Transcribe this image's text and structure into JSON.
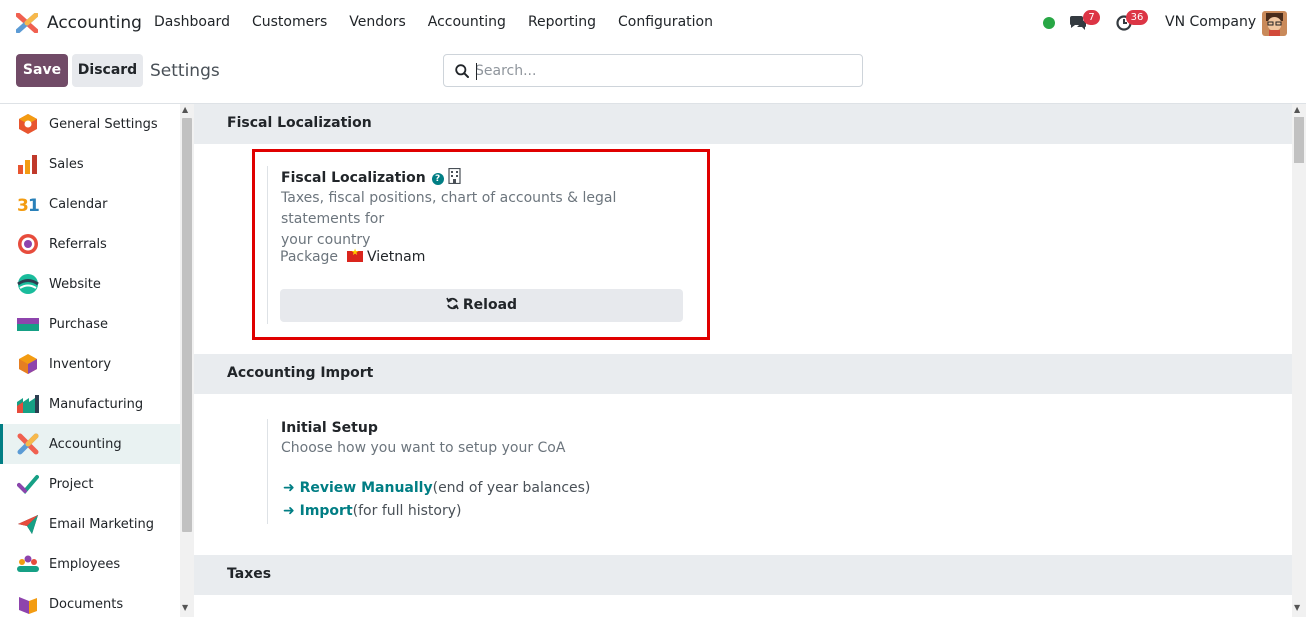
{
  "app": {
    "name": "Accounting"
  },
  "menu": [
    "Dashboard",
    "Customers",
    "Vendors",
    "Accounting",
    "Reporting",
    "Configuration"
  ],
  "systray": {
    "chat_count": "7",
    "activity_count": "36",
    "company": "VN Company"
  },
  "control": {
    "save_label": "Save",
    "discard_label": "Discard",
    "title": "Settings",
    "search_placeholder": "Search..."
  },
  "sidebar": {
    "items": [
      {
        "label": "General Settings",
        "icon": "general-settings-icon"
      },
      {
        "label": "Sales",
        "icon": "sales-icon"
      },
      {
        "label": "Calendar",
        "icon": "calendar-icon"
      },
      {
        "label": "Referrals",
        "icon": "referrals-icon"
      },
      {
        "label": "Website",
        "icon": "website-icon"
      },
      {
        "label": "Purchase",
        "icon": "purchase-icon"
      },
      {
        "label": "Inventory",
        "icon": "inventory-icon"
      },
      {
        "label": "Manufacturing",
        "icon": "manufacturing-icon"
      },
      {
        "label": "Accounting",
        "icon": "accounting-icon"
      },
      {
        "label": "Project",
        "icon": "project-icon"
      },
      {
        "label": "Email Marketing",
        "icon": "email-marketing-icon"
      },
      {
        "label": "Employees",
        "icon": "employees-icon"
      },
      {
        "label": "Documents",
        "icon": "documents-icon"
      }
    ],
    "active": "Accounting"
  },
  "sections": {
    "fiscal": {
      "header": "Fiscal Localization",
      "title": "Fiscal Localization",
      "desc_line1": "Taxes, fiscal positions, chart of accounts & legal statements for",
      "desc_line2": "your country",
      "package_label": "Package",
      "package_value": "Vietnam",
      "reload_label": "Reload"
    },
    "import": {
      "header": "Accounting Import",
      "title": "Initial Setup",
      "desc": "Choose how you want to setup your CoA",
      "link1": "Review Manually",
      "link1_note": "(end of year balances)",
      "link2": "Import",
      "link2_note": "(for full history)"
    },
    "taxes": {
      "header": "Taxes"
    }
  },
  "colors": {
    "brand": "#714b67",
    "accent": "#017e84",
    "highlight": "#e00000"
  }
}
